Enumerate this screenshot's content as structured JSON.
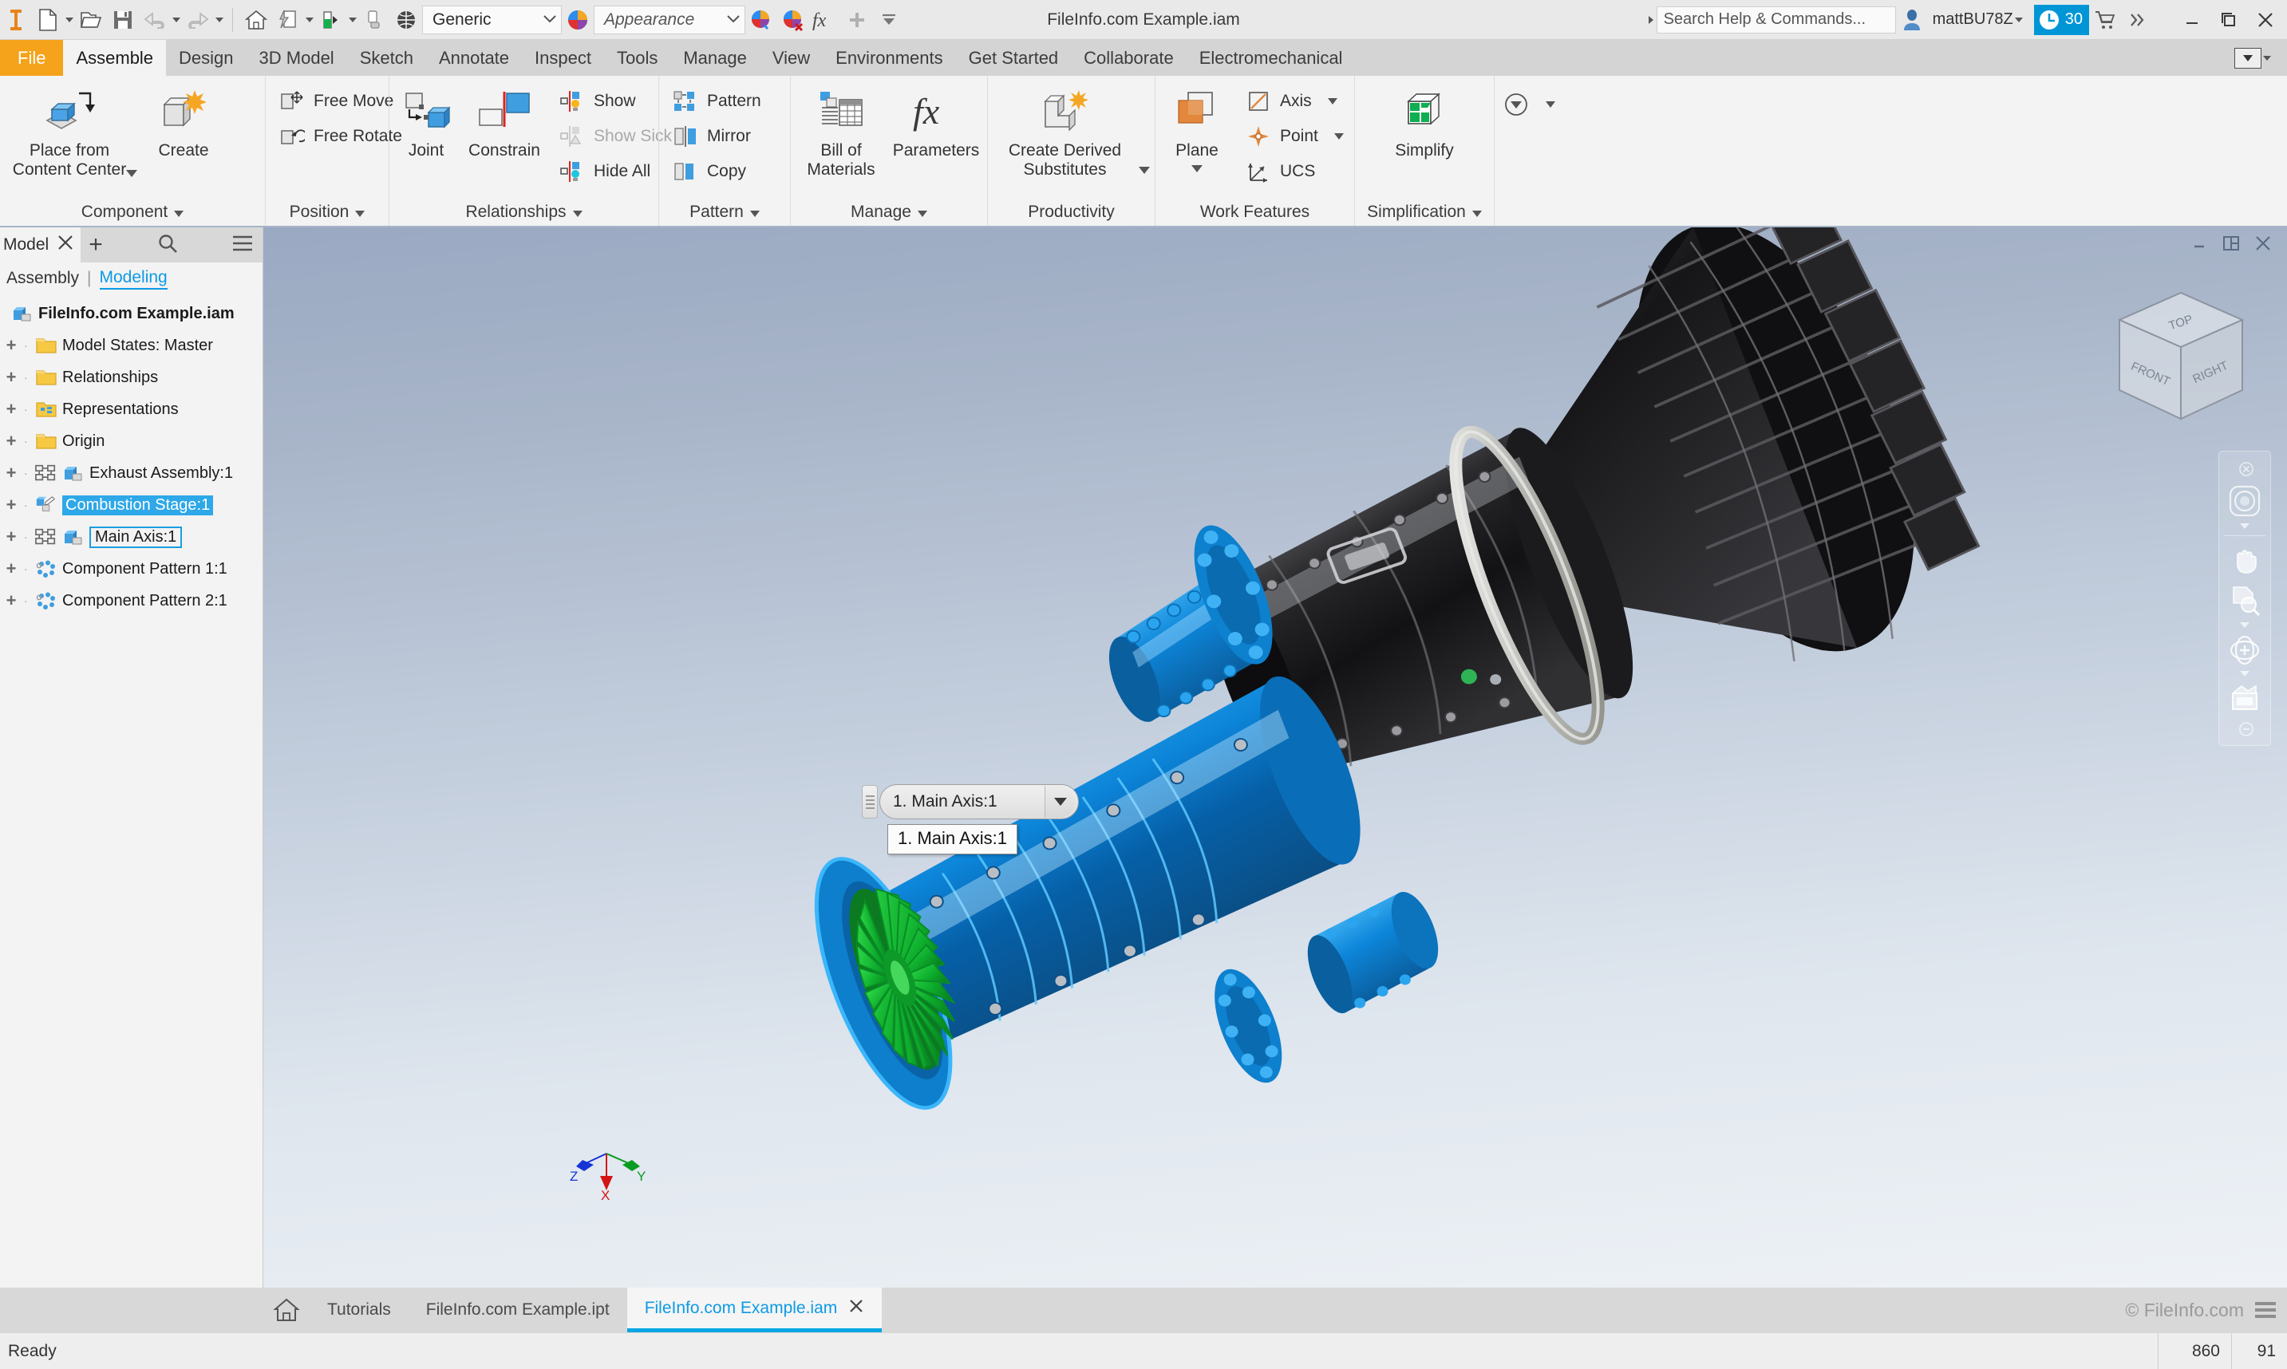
{
  "quick_access": {
    "app_icon": "inventor-logo-icon",
    "buttons": [
      {
        "name": "new-file-button",
        "icon": "new-document-icon",
        "has_caret": true
      },
      {
        "name": "open-file-button",
        "icon": "open-folder-icon",
        "has_caret": false
      },
      {
        "name": "save-button",
        "icon": "floppy-save-icon",
        "has_caret": false
      },
      {
        "name": "undo-button",
        "icon": "undo-arrow-icon",
        "has_caret": true
      },
      {
        "name": "redo-button",
        "icon": "redo-arrow-icon",
        "has_caret": true
      },
      {
        "name": "home-view-button",
        "icon": "home-icon",
        "has_caret": false
      },
      {
        "name": "sketch-visibility-button",
        "icon": "sketch-lightning-icon",
        "has_caret": true
      },
      {
        "name": "material-button",
        "icon": "material-swatch-icon",
        "has_caret": true
      },
      {
        "name": "clear-button",
        "icon": "clear-appearance-icon",
        "has_caret": false
      },
      {
        "name": "transparency-button",
        "icon": "sphere-grid-icon",
        "has_caret": false
      }
    ],
    "material_combo": {
      "value": "Generic",
      "placeholder": "Material"
    },
    "appearance_combo": {
      "value": "Appearance",
      "placeholder": "Appearance"
    },
    "after_appearance_buttons": [
      {
        "name": "adjust-appearance-button",
        "icon": "color-wheel-icon"
      },
      {
        "name": "clear-appearance-button",
        "icon": "color-wheel-clear-icon"
      },
      {
        "name": "parameters-fx-button",
        "icon": "fx-icon"
      },
      {
        "name": "add-to-quick-access-button",
        "icon": "plus-icon"
      },
      {
        "name": "quick-access-overflow-button",
        "icon": "chevron-down-bar-icon"
      }
    ],
    "document_title": "FileInfo.com Example.iam",
    "search": {
      "value": "Search Help & Commands...",
      "placeholder": "Search Help & Commands..."
    },
    "account": {
      "name": "mattBU78Z",
      "icon": "user-avatar-icon"
    },
    "trial_badge": {
      "icon": "clock-icon",
      "days": "30",
      "cart_icon": "shopping-cart-icon",
      "overflow": "»"
    },
    "window_controls": {
      "minimize": "minimize-icon",
      "restore": "restore-icon",
      "close": "close-icon"
    }
  },
  "ribbon": {
    "tabs": [
      {
        "label": "File",
        "style": "file"
      },
      {
        "label": "Assemble",
        "style": "active"
      },
      {
        "label": "Design",
        "style": "normal"
      },
      {
        "label": "3D Model",
        "style": "normal"
      },
      {
        "label": "Sketch",
        "style": "normal"
      },
      {
        "label": "Annotate",
        "style": "normal"
      },
      {
        "label": "Inspect",
        "style": "normal"
      },
      {
        "label": "Tools",
        "style": "normal"
      },
      {
        "label": "Manage",
        "style": "normal"
      },
      {
        "label": "View",
        "style": "normal"
      },
      {
        "label": "Environments",
        "style": "normal"
      },
      {
        "label": "Get Started",
        "style": "normal"
      },
      {
        "label": "Collaborate",
        "style": "normal"
      },
      {
        "label": "Electromechanical",
        "style": "normal"
      }
    ],
    "collapse_button": "ribbon-collapse-icon",
    "panels": [
      {
        "title": "Component",
        "has_dropdown": true,
        "big_buttons": [
          {
            "label": "Place from Content Center",
            "icon": "place-component-icon",
            "has_caret": true
          },
          {
            "label": "Create",
            "icon": "create-component-icon",
            "has_caret": false
          }
        ],
        "small_buttons": []
      },
      {
        "title": "Position",
        "has_dropdown": true,
        "big_buttons": [],
        "small_buttons": [
          {
            "label": "Free Move",
            "icon": "free-move-icon",
            "enabled": true
          },
          {
            "label": "Free Rotate",
            "icon": "free-rotate-icon",
            "enabled": true
          }
        ]
      },
      {
        "title": "Relationships",
        "has_dropdown": true,
        "big_buttons": [
          {
            "label": "Joint",
            "icon": "joint-icon",
            "has_caret": false
          },
          {
            "label": "Constrain",
            "icon": "constrain-icon",
            "has_caret": false
          }
        ],
        "small_buttons": [
          {
            "label": "Show",
            "icon": "show-relationships-icon",
            "enabled": true
          },
          {
            "label": "Show Sick",
            "icon": "show-sick-icon",
            "enabled": false
          },
          {
            "label": "Hide All",
            "icon": "hide-all-icon",
            "enabled": true
          }
        ]
      },
      {
        "title": "Pattern",
        "has_dropdown": true,
        "big_buttons": [],
        "small_buttons": [
          {
            "label": "Pattern",
            "icon": "pattern-icon",
            "enabled": true
          },
          {
            "label": "Mirror",
            "icon": "mirror-icon",
            "enabled": true
          },
          {
            "label": "Copy",
            "icon": "copy-icon",
            "enabled": true
          }
        ]
      },
      {
        "title": "Manage",
        "has_dropdown": true,
        "big_buttons": [
          {
            "label": "Bill of Materials",
            "icon": "bill-of-materials-icon",
            "has_caret": false
          },
          {
            "label": "Parameters",
            "icon": "fx-parameters-icon",
            "has_caret": false
          }
        ],
        "small_buttons": []
      },
      {
        "title": "Productivity",
        "has_dropdown": false,
        "big_buttons": [
          {
            "label": "Create Derived Substitutes",
            "icon": "derived-substitute-icon",
            "has_caret": true
          }
        ],
        "small_buttons": []
      },
      {
        "title": "Work Features",
        "has_dropdown": false,
        "big_buttons": [
          {
            "label": "Plane",
            "icon": "work-plane-icon",
            "has_caret": true
          }
        ],
        "small_buttons": [
          {
            "label": "Axis",
            "icon": "work-axis-icon",
            "enabled": true,
            "caret": true
          },
          {
            "label": "Point",
            "icon": "work-point-icon",
            "enabled": true,
            "caret": true
          },
          {
            "label": "UCS",
            "icon": "ucs-icon",
            "enabled": true,
            "caret": false
          }
        ]
      },
      {
        "title": "Simplification",
        "has_dropdown": true,
        "big_buttons": [
          {
            "label": "Simplify",
            "icon": "simplify-icon",
            "has_caret": false
          }
        ],
        "small_buttons": []
      },
      {
        "title": "",
        "has_dropdown": false,
        "big_buttons": [],
        "small_buttons": [
          {
            "label": "",
            "icon": "convert-overflow-icon",
            "enabled": true,
            "caret": true
          }
        ]
      }
    ]
  },
  "browser": {
    "tab_label": "Model",
    "close_icon": "close-icon",
    "add_icon": "plus-icon",
    "search_icon": "search-icon",
    "menu_icon": "hamburger-menu-icon",
    "filters": {
      "assembly": "Assembly",
      "separator": "|",
      "modeling": "Modeling"
    },
    "tree": [
      {
        "label": "FileInfo.com Example.iam",
        "icon": "assembly-icon",
        "indent": 0,
        "expandable": false,
        "state": "root"
      },
      {
        "label": "Model States: Master",
        "icon": "folder-icon",
        "indent": 1,
        "expandable": true,
        "state": "normal"
      },
      {
        "label": "Relationships",
        "icon": "folder-icon",
        "indent": 1,
        "expandable": true,
        "state": "normal"
      },
      {
        "label": "Representations",
        "icon": "representations-folder-icon",
        "indent": 1,
        "expandable": true,
        "state": "normal"
      },
      {
        "label": "Origin",
        "icon": "folder-icon",
        "indent": 1,
        "expandable": true,
        "state": "normal"
      },
      {
        "label": "Exhaust Assembly:1",
        "icon": "subassembly-icon",
        "indent": 1,
        "expandable": true,
        "state": "normal"
      },
      {
        "label": "Combustion Stage:1",
        "icon": "part-edit-icon",
        "indent": 1,
        "expandable": true,
        "state": "selected"
      },
      {
        "label": "Main Axis:1",
        "icon": "subassembly-icon",
        "indent": 1,
        "expandable": true,
        "state": "boxed"
      },
      {
        "label": "Component Pattern 1:1",
        "icon": "component-pattern-icon",
        "indent": 1,
        "expandable": true,
        "state": "normal"
      },
      {
        "label": "Component Pattern 2:1",
        "icon": "component-pattern-icon",
        "indent": 1,
        "expandable": true,
        "state": "normal"
      }
    ]
  },
  "viewport": {
    "window_controls": {
      "minimize": "minimize-icon",
      "restore": "restore-window-icon",
      "close": "close-icon"
    },
    "viewcube": {
      "top": "TOP",
      "front": "FRONT",
      "right": "RIGHT"
    },
    "navbar": [
      {
        "name": "close-navbar-button",
        "icon": "close-small-icon"
      },
      {
        "name": "full-navigation-wheel-button",
        "icon": "steering-wheel-icon",
        "caret": true
      },
      {
        "name": "pan-button",
        "icon": "hand-pan-icon",
        "caret": false
      },
      {
        "name": "zoom-button",
        "icon": "zoom-magnifier-icon",
        "caret": true
      },
      {
        "name": "orbit-button",
        "icon": "orbit-icon",
        "caret": true
      },
      {
        "name": "look-at-button",
        "icon": "look-at-icon",
        "caret": false
      },
      {
        "name": "navbar-options-button",
        "icon": "minus-circle-icon"
      }
    ],
    "triad": {
      "x_label": "X",
      "y_label": "Y",
      "z_label": "Z"
    },
    "selected_component_combo": {
      "value": "1. Main Axis:1",
      "grip": "drag-grip-icon",
      "caret": "chevron-down-icon"
    },
    "tooltip": "1. Main Axis:1"
  },
  "doc_tabs": {
    "home_icon": "home-icon",
    "tabs": [
      {
        "label": "Tutorials",
        "active": false,
        "closable": false
      },
      {
        "label": "FileInfo.com Example.ipt",
        "active": false,
        "closable": false
      },
      {
        "label": "FileInfo.com Example.iam",
        "active": true,
        "closable": true
      }
    ],
    "watermark": "© FileInfo.com",
    "menu_icon": "hamburger-menu-icon"
  },
  "statusbar": {
    "message": "Ready",
    "value_1": "860",
    "value_2": "91"
  },
  "colors": {
    "accent_blue": "#0d9ae5",
    "file_tab_orange": "#f5a31a",
    "selection_blue": "#2ea8e8",
    "model_blue": "#0a74c4",
    "model_green": "#16b33a",
    "viewport_bg_top": "#9aa9c2",
    "viewport_bg_bottom": "#eef2f6"
  }
}
